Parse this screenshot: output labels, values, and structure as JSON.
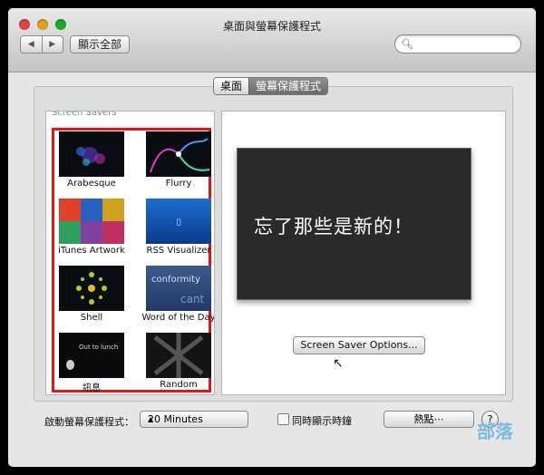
{
  "window": {
    "title": "桌面與螢幕保護程式"
  },
  "toolbar": {
    "back": "◀",
    "forward": "▶",
    "show_all": "顯示全部"
  },
  "tabs": [
    {
      "label": "桌面",
      "selected": false
    },
    {
      "label": "螢幕保護程式",
      "selected": true
    }
  ],
  "list": {
    "header": "Screen Savers",
    "items": [
      {
        "label": "Arabesque"
      },
      {
        "label": "Flurry"
      },
      {
        "label": "iTunes Artwork"
      },
      {
        "label": "RSS Visualizer"
      },
      {
        "label": "Shell"
      },
      {
        "label": "Word of the Day"
      },
      {
        "label": "訊息"
      },
      {
        "label": "Random"
      }
    ],
    "highlight_color": "#e0161d"
  },
  "preview": {
    "text": "忘了那些是新的！",
    "thumb_word": "conformity",
    "thumb_word2": "cant",
    "thumb_message": "Out to lunch"
  },
  "options_button": "Screen Saver Options...",
  "bottom": {
    "start_label": "啟動螢幕保護程式：",
    "start_value": "20 Minutes",
    "clock_label": "同時顯示時鐘",
    "hot_corners": "熱點⋯",
    "help": "?"
  },
  "watermark": {
    "text": "部落"
  }
}
